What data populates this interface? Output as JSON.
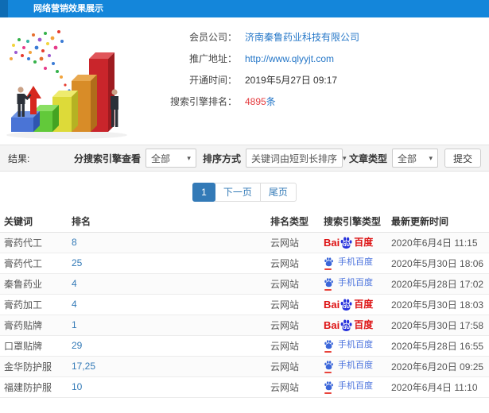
{
  "header": {
    "title": "网络营销效果展示"
  },
  "info": {
    "member_label": "会员公司：",
    "member_value": "济南秦鲁药业科技有限公司",
    "url_label": "推广地址：",
    "url_value": "http://www.qlyyjt.com",
    "open_label": "开通时间：",
    "open_value": "2019年5月27日 09:17",
    "rank_label": "搜索引擎排名：",
    "rank_number": "4895",
    "rank_unit": "条"
  },
  "filters": {
    "result_label": "结果:",
    "engine_label": "分搜索引擎查看",
    "engine_value": "全部",
    "sort_label": "排序方式",
    "sort_value": "关键词由短到长排序",
    "article_label": "文章类型",
    "article_value": "全部",
    "submit_label": "提交"
  },
  "pagination": {
    "current": "1",
    "next": "下一页",
    "last": "尾页"
  },
  "table": {
    "headers": [
      "关键词",
      "排名",
      "排名类型",
      "搜索引擎类型",
      "最新更新时间"
    ],
    "rows": [
      {
        "keyword": "膏药代工",
        "rank": "8",
        "rank_type": "云网站",
        "engine": "baidu",
        "time": "2020年6月4日 11:15"
      },
      {
        "keyword": "膏药代工",
        "rank": "25",
        "rank_type": "云网站",
        "engine": "mobile",
        "time": "2020年5月30日 18:06"
      },
      {
        "keyword": "秦鲁药业",
        "rank": "4",
        "rank_type": "云网站",
        "engine": "mobile",
        "time": "2020年5月28日 17:02"
      },
      {
        "keyword": "膏药加工",
        "rank": "4",
        "rank_type": "云网站",
        "engine": "baidu",
        "time": "2020年5月30日 18:03"
      },
      {
        "keyword": "膏药贴牌",
        "rank": "1",
        "rank_type": "云网站",
        "engine": "baidu",
        "time": "2020年5月30日 17:58"
      },
      {
        "keyword": "口罩贴牌",
        "rank": "29",
        "rank_type": "云网站",
        "engine": "mobile",
        "time": "2020年5月28日 16:55"
      },
      {
        "keyword": "金华防护服",
        "rank": "17,25",
        "rank_type": "云网站",
        "engine": "mobile",
        "time": "2020年6月20日 09:25"
      },
      {
        "keyword": "福建防护服",
        "rank": "10",
        "rank_type": "云网站",
        "engine": "mobile",
        "time": "2020年6月4日 11:10"
      }
    ]
  },
  "engines": {
    "baidu": {
      "bai": "Bai",
      "du": "du",
      "name": "百度"
    },
    "mobile": {
      "name": "手机百度"
    }
  },
  "icons": {
    "caret": "▾"
  },
  "colors": {
    "header_blue": "#1486da",
    "header_accent": "#0e6cb4",
    "link_blue": "#2577c8",
    "highlight_red": "#e4393c",
    "active_page_blue": "#337ab7",
    "baidu_red": "#dd1112",
    "baidu_blue": "#2732dc",
    "mobile_baidu_blue": "#4a72dd",
    "filter_bg": "#f4f4f4"
  }
}
